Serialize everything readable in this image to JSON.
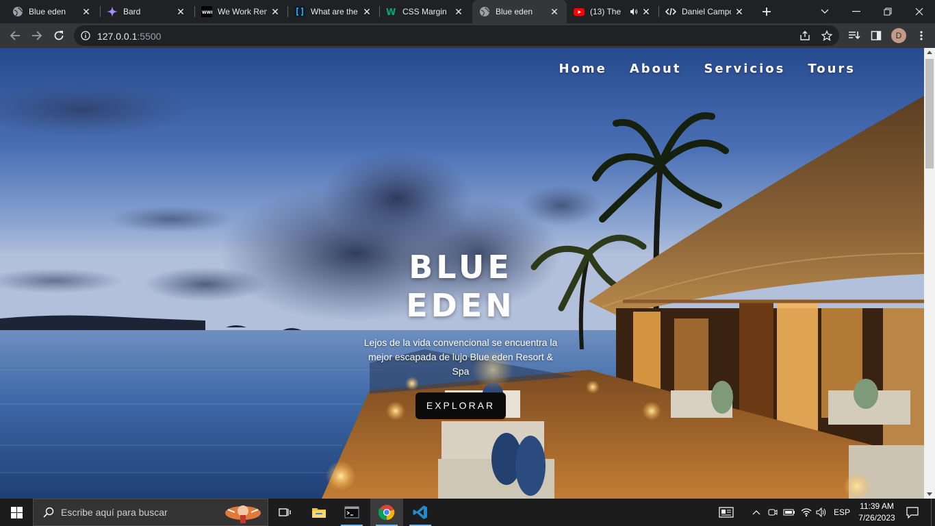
{
  "browser": {
    "tabs": [
      {
        "title": "Blue eden",
        "favicon": "globe-icon",
        "active": false
      },
      {
        "title": "Bard",
        "favicon": "bard-sparkle-icon",
        "active": false
      },
      {
        "title": "We Work Remotely",
        "favicon": "wwr-icon",
        "active": false
      },
      {
        "title": "What are the",
        "favicon": "brackets-icon",
        "active": false
      },
      {
        "title": "CSS Margin",
        "favicon": "w3schools-icon",
        "active": false
      },
      {
        "title": "Blue eden",
        "favicon": "globe-icon",
        "active": true
      },
      {
        "title": "(13) The",
        "favicon": "youtube-icon",
        "active": false,
        "audio": true
      },
      {
        "title": "Daniel Campos",
        "favicon": "code-icon",
        "active": false
      }
    ],
    "url": {
      "host": "127.0.0.1",
      "port": ":5500"
    },
    "profile_initial": "D"
  },
  "site": {
    "nav": [
      "Home",
      "About",
      "Servicios",
      "Tours"
    ],
    "hero": {
      "title": "BLUE EDEN",
      "subtitle": "Lejos de la vida convencional se encuentra la mejor escapada de lujo Blue eden Resort & Spa",
      "cta": "EXPLORAR"
    }
  },
  "taskbar": {
    "search_placeholder": "Escribe aquí para buscar",
    "language": "ESP",
    "time": "11:39 AM",
    "date": "7/26/2023"
  },
  "colors": {
    "chrome_dark": "#202124",
    "chrome_toolbar": "#35363a",
    "taskbar": "#1c1c1c",
    "cta_bg": "#0b0b0b"
  }
}
